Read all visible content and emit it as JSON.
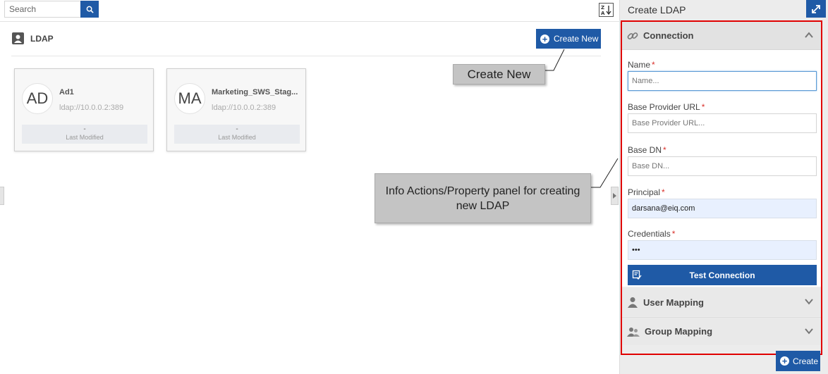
{
  "search": {
    "placeholder": "Search"
  },
  "header": {
    "title": "LDAP",
    "create_new_label": "Create New"
  },
  "cards": [
    {
      "initials": "AD",
      "name": "Ad1",
      "url": "ldap://10.0.0.2:389",
      "modified_value": "-",
      "modified_label": "Last Modified"
    },
    {
      "initials": "MA",
      "name": "Marketing_SWS_Stag...",
      "url": "ldap://10.0.0.2:389",
      "modified_value": "-",
      "modified_label": "Last Modified"
    }
  ],
  "callouts": {
    "create_new": "Create New",
    "info_panel": "Info Actions/Property panel for creating new LDAP"
  },
  "panel": {
    "title": "Create LDAP",
    "connection": {
      "title": "Connection",
      "fields": [
        {
          "label": "Name",
          "placeholder": "Name...",
          "value": ""
        },
        {
          "label": "Base Provider URL",
          "placeholder": "Base Provider URL...",
          "value": ""
        },
        {
          "label": "Base DN",
          "placeholder": "Base DN...",
          "value": ""
        },
        {
          "label": "Principal",
          "placeholder": "",
          "value": "darsana@eiq.com"
        },
        {
          "label": "Credentials",
          "placeholder": "",
          "value": "•••"
        }
      ],
      "required_mark": "*",
      "test_button": "Test Connection"
    },
    "user_mapping": "User Mapping",
    "group_mapping": "Group Mapping",
    "create_button": "Create"
  },
  "colors": {
    "accent": "#1f5aa6",
    "required": "#d9312b",
    "highlight_frame": "#e00000",
    "autofill": "#e8f0fe"
  },
  "icons": [
    "search-icon",
    "sort-az-icon",
    "user-card-icon",
    "plus-circle-icon",
    "link-icon",
    "chevron-up-icon",
    "chevron-down-icon",
    "test-connection-icon",
    "user-icon",
    "group-icon",
    "expand-icon",
    "arrow-right-icon"
  ]
}
